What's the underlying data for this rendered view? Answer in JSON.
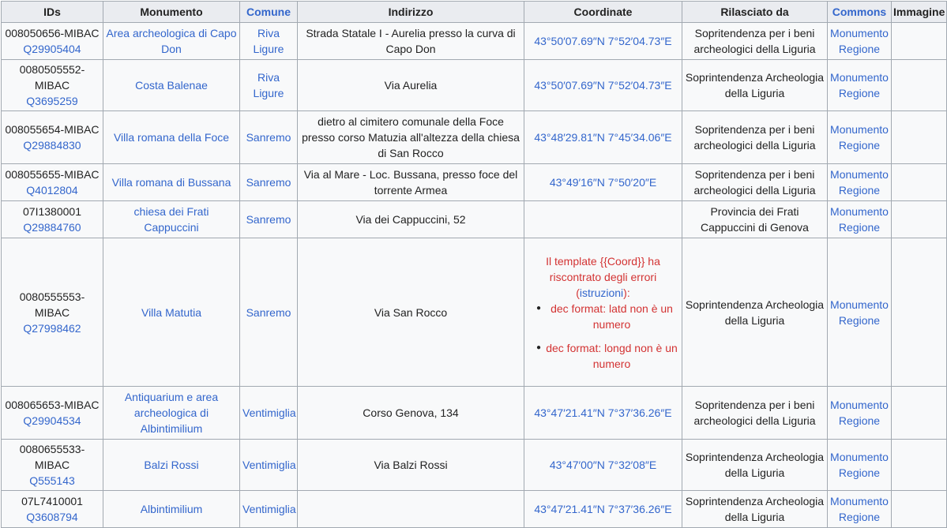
{
  "headers": {
    "ids": "IDs",
    "monumento": "Monumento",
    "comune": "Comune",
    "indirizzo": "Indirizzo",
    "coordinate": "Coordinate",
    "rilasciato": "Rilasciato da",
    "commons": "Commons",
    "immagine": "Immagine"
  },
  "rows": [
    {
      "id": "008050656-MIBAC",
      "wikidata": "Q29905404",
      "monumento": "Area archeologica di Capo Don",
      "comune": "Riva Ligure",
      "indirizzo": "Strada Statale I - Aurelia presso la curva di Capo Don",
      "coord": "43°50′07.69″N 7°52′04.73″E",
      "rilasciato": "Sopritendenza per i beni archeologici della Liguria",
      "commons1": "Monumento",
      "commons2": "Regione"
    },
    {
      "id": "0080505552-MIBAC",
      "wikidata": "Q3695259",
      "monumento": "Costa Balenae",
      "comune": "Riva Ligure",
      "indirizzo": "Via Aurelia",
      "coord": "43°50′07.69″N 7°52′04.73″E",
      "rilasciato": "Soprintendenza Archeologia della Liguria",
      "commons1": "Monumento",
      "commons2": "Regione"
    },
    {
      "id": "008055654-MIBAC",
      "wikidata": "Q29884830",
      "monumento": "Villa romana della Foce",
      "comune": "Sanremo",
      "indirizzo": "dietro al cimitero comunale della Foce presso corso Matuzia all'altezza della chiesa di San Rocco",
      "coord": "43°48′29.81″N 7°45′34.06″E",
      "rilasciato": "Sopritendenza per i beni archeologici della Liguria",
      "commons1": "Monumento",
      "commons2": "Regione"
    },
    {
      "id": "008055655-MIBAC",
      "wikidata": "Q4012804",
      "monumento": "Villa romana di Bussana",
      "comune": "Sanremo",
      "indirizzo": "Via al Mare - Loc. Bussana, presso foce del torrente Armea",
      "coord": "43°49′16″N 7°50′20″E",
      "rilasciato": "Sopritendenza per i beni archeologici della Liguria",
      "commons1": "Monumento",
      "commons2": "Regione"
    },
    {
      "id": "07I1380001",
      "wikidata": "Q29884760",
      "monumento": "chiesa dei Frati Cappuccini",
      "comune": "Sanremo",
      "indirizzo": "Via dei Cappuccini, 52",
      "coord": "",
      "rilasciato": "Provincia dei Frati Cappuccini di Genova",
      "commons1": "Monumento",
      "commons2": "Regione"
    },
    {
      "id": "0080555553-MIBAC",
      "wikidata": "Q27998462",
      "monumento": "Villa Matutia",
      "comune": "Sanremo",
      "indirizzo": "Via San Rocco",
      "coord": "",
      "coord_error": {
        "pre": "Il template {{Coord}} ha riscontrato degli errori (",
        "link": "istruzioni",
        "post": "):",
        "items": [
          "dec format: latd non è un numero",
          "dec format: longd non è un numero"
        ]
      },
      "rilasciato": "Soprintendenza Archeologia della Liguria",
      "commons1": "Monumento",
      "commons2": "Regione"
    },
    {
      "id": "008065653-MIBAC",
      "wikidata": "Q29904534",
      "monumento": "Antiquarium e area archeologica di Albintimilium",
      "comune": "Ventimiglia",
      "indirizzo": "Corso Genova, 134",
      "coord": "43°47′21.41″N 7°37′36.26″E",
      "rilasciato": "Sopritendenza per i beni archeologici della Liguria",
      "commons1": "Monumento",
      "commons2": "Regione"
    },
    {
      "id": "0080655533-MIBAC",
      "wikidata": "Q555143",
      "monumento": "Balzi Rossi",
      "comune": "Ventimiglia",
      "indirizzo": "Via Balzi Rossi",
      "coord": "43°47′00″N 7°32′08″E",
      "rilasciato": "Soprintendenza Archeologia della Liguria",
      "commons1": "Monumento",
      "commons2": "Regione"
    },
    {
      "id": "07L7410001",
      "wikidata": "Q3608794",
      "monumento": "Albintimilium",
      "comune": "Ventimiglia",
      "indirizzo": "",
      "coord": "43°47′21.41″N 7°37′36.26″E",
      "rilasciato": "Soprintendenza Archeologia della Liguria",
      "commons1": "Monumento",
      "commons2": "Regione"
    }
  ]
}
